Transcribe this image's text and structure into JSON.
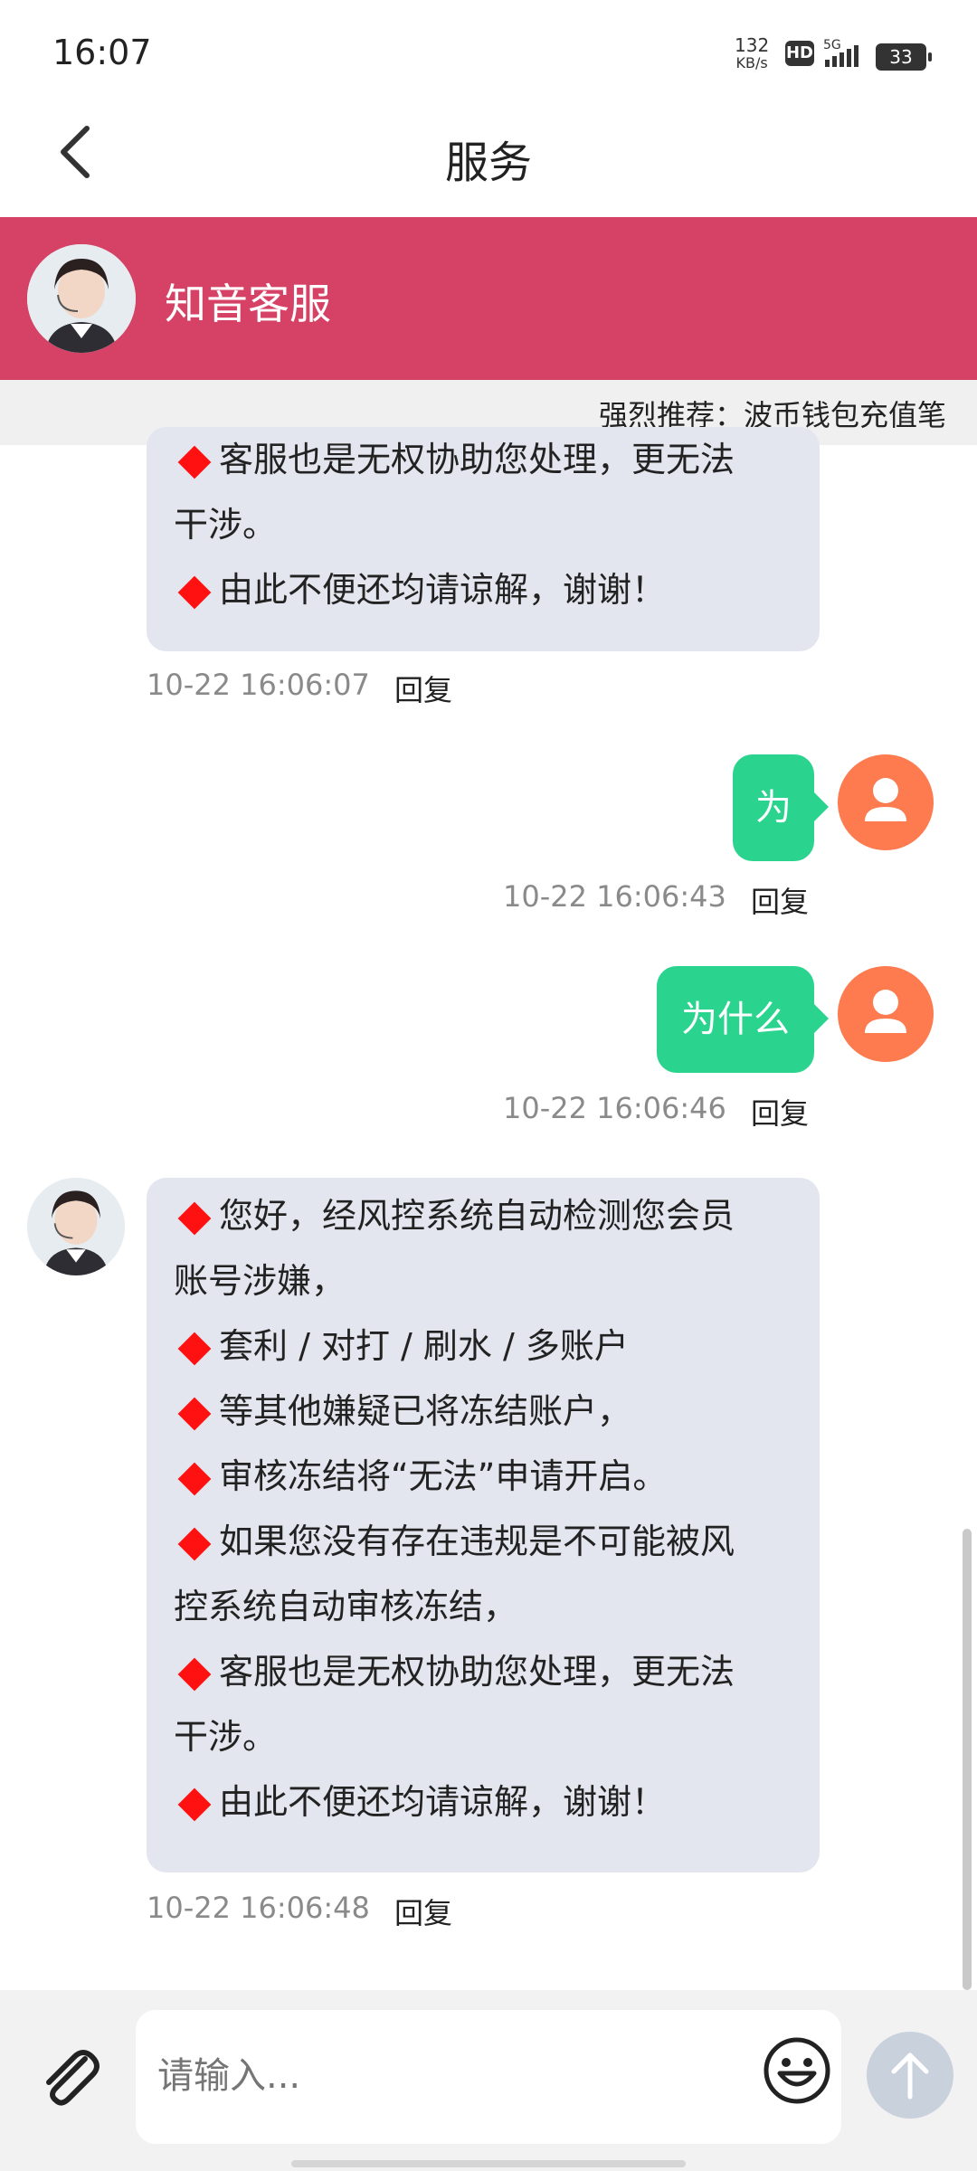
{
  "status": {
    "time": "16:07",
    "net_speed": "132",
    "net_unit": "KB/s",
    "hd": "HD",
    "gen": "5G",
    "battery": "33"
  },
  "header": {
    "title": "服务"
  },
  "agent": {
    "name": "知音客服"
  },
  "ticker": {
    "text": "强烈推荐：波币钱包充值笔"
  },
  "messages": {
    "first": {
      "lines": [
        "客服也是无权协助您处理，更无法",
        "干涉。",
        "由此不便还均请谅解，谢谢！"
      ],
      "time": "10-22 16:06:07",
      "reply": "回复"
    },
    "user1": {
      "text": "为",
      "time": "10-22 16:06:43",
      "reply": "回复"
    },
    "user2": {
      "text": "为什么",
      "time": "10-22 16:06:46",
      "reply": "回复"
    },
    "last": {
      "lines": [
        "您好，经风控系统自动检测您会员",
        "账号涉嫌，",
        "套利 / 对打 / 刷水 / 多账户",
        "等其他嫌疑已将冻结账户，",
        "审核冻结将“无法”申请开启。",
        "如果您没有存在违规是不可能被风",
        "控系统自动审核冻结，",
        "客服也是无权协助您处理，更无法",
        "干涉。",
        "由此不便还均请谅解，谢谢！"
      ],
      "time": "10-22 16:06:48",
      "reply": "回复"
    }
  },
  "input": {
    "placeholder": "请输入..."
  },
  "icons": {
    "attach": "paperclip-icon",
    "emoji": "smile-icon",
    "send": "arrow-up-icon",
    "back": "chevron-left-icon"
  },
  "colors": {
    "agent_bar": "#d64266",
    "user_bubble": "#2ad48e",
    "user_avatar": "#fd7b4f",
    "agent_bubble": "#e3e6ee"
  }
}
